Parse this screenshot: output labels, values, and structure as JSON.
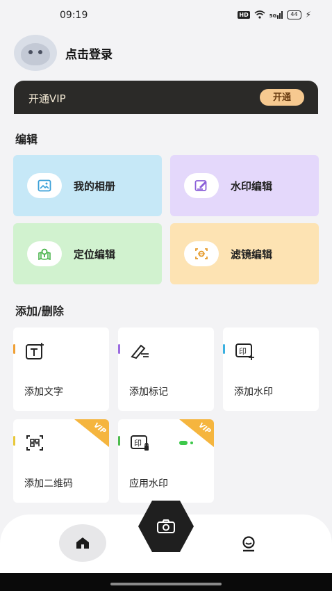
{
  "status": {
    "time": "09:19",
    "hd": "HD",
    "network": "5G",
    "battery": "44"
  },
  "profile": {
    "login_label": "点击登录"
  },
  "vip": {
    "title": "开通VIP",
    "button": "开通"
  },
  "sections": {
    "edit": "编辑",
    "add_delete": "添加/删除"
  },
  "edit_cards": [
    {
      "label": "我的相册",
      "icon": "photo-album-icon",
      "bg": "#c6e8f7",
      "icon_color": "#3aa0d8"
    },
    {
      "label": "水印编辑",
      "icon": "watermark-edit-icon",
      "bg": "#e4d8fb",
      "icon_color": "#8a5fd8"
    },
    {
      "label": "定位编辑",
      "icon": "location-edit-icon",
      "bg": "#d1f2cf",
      "icon_color": "#48b34a"
    },
    {
      "label": "滤镜编辑",
      "icon": "filter-edit-icon",
      "bg": "#fde3b3",
      "icon_color": "#e59a2a"
    }
  ],
  "tools": [
    {
      "label": "添加文字",
      "icon": "add-text-icon",
      "accent": "#f0a035",
      "vip": false
    },
    {
      "label": "添加标记",
      "icon": "add-mark-icon",
      "accent": "#9b6be0",
      "vip": false
    },
    {
      "label": "添加水印",
      "icon": "add-watermark-icon",
      "accent": "#3ab0e0",
      "vip": false
    },
    {
      "label": "添加二维码",
      "icon": "qr-code-icon",
      "accent": "#e8c83a",
      "vip": true,
      "vip_label": "VIP"
    },
    {
      "label": "应用水印",
      "icon": "apply-watermark-icon",
      "accent": "#4dbb4d",
      "vip": true,
      "vip_label": "VIP",
      "toggle_on": true
    }
  ],
  "nav": {
    "items": [
      "home-icon",
      "camera-icon",
      "profile-icon"
    ]
  }
}
